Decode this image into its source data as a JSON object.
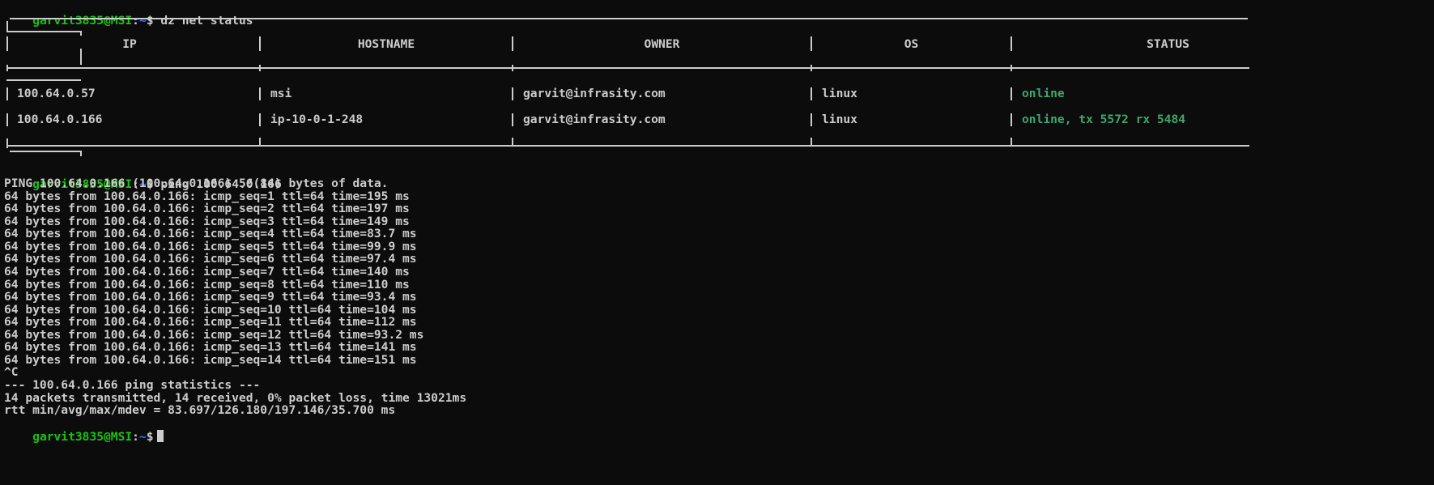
{
  "prompt": {
    "user": "garvit3835@MSI",
    "sep": ":",
    "path": "~",
    "sigil": "$"
  },
  "commands": [
    "dz net status",
    "ping 100.64.0.166",
    ""
  ],
  "table": {
    "headers": [
      "IP",
      "HOSTNAME",
      "OWNER",
      "OS",
      "STATUS"
    ],
    "rows": [
      [
        "100.64.0.57",
        "msi",
        "garvit@infrasity.com",
        "linux",
        "online"
      ],
      [
        "100.64.0.166",
        "ip-10-0-1-248",
        "garvit@infrasity.com",
        "linux",
        "online, tx 5572 rx 5484"
      ]
    ]
  },
  "ping_output": [
    "PING 100.64.0.166 (100.64.0.166) 56(84) bytes of data.",
    "64 bytes from 100.64.0.166: icmp_seq=1 ttl=64 time=195 ms",
    "64 bytes from 100.64.0.166: icmp_seq=2 ttl=64 time=197 ms",
    "64 bytes from 100.64.0.166: icmp_seq=3 ttl=64 time=149 ms",
    "64 bytes from 100.64.0.166: icmp_seq=4 ttl=64 time=83.7 ms",
    "64 bytes from 100.64.0.166: icmp_seq=5 ttl=64 time=99.9 ms",
    "64 bytes from 100.64.0.166: icmp_seq=6 ttl=64 time=97.4 ms",
    "64 bytes from 100.64.0.166: icmp_seq=7 ttl=64 time=140 ms",
    "64 bytes from 100.64.0.166: icmp_seq=8 ttl=64 time=110 ms",
    "64 bytes from 100.64.0.166: icmp_seq=9 ttl=64 time=93.4 ms",
    "64 bytes from 100.64.0.166: icmp_seq=10 ttl=64 time=104 ms",
    "64 bytes from 100.64.0.166: icmp_seq=11 ttl=64 time=112 ms",
    "64 bytes from 100.64.0.166: icmp_seq=12 ttl=64 time=93.2 ms",
    "64 bytes from 100.64.0.166: icmp_seq=13 ttl=64 time=141 ms",
    "64 bytes from 100.64.0.166: icmp_seq=14 ttl=64 time=151 ms",
    "^C",
    "--- 100.64.0.166 ping statistics ---",
    "14 packets transmitted, 14 received, 0% packet loss, time 13021ms",
    "rtt min/avg/max/mdev = 83.697/126.180/197.146/35.700 ms"
  ],
  "colors": {
    "background": "#0c0c0c",
    "foreground": "#cccccc",
    "prompt_user": "#16c60c",
    "prompt_path": "#3b78ff",
    "status_online": "#3fa66c"
  }
}
